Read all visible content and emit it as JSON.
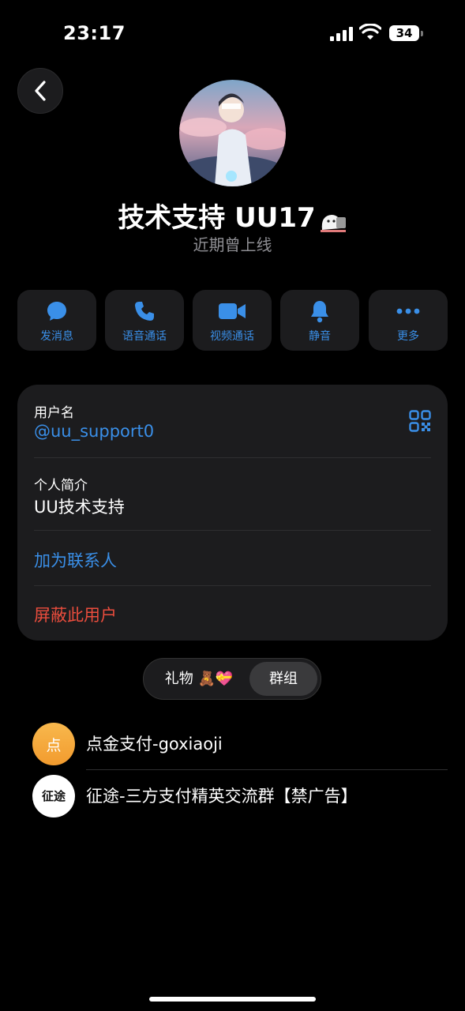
{
  "status_bar": {
    "time": "23:17",
    "battery": "34"
  },
  "profile": {
    "name": "技术支持 UU17",
    "last_seen": "近期曾上线"
  },
  "actions": [
    {
      "label": "发消息",
      "icon": "message-icon"
    },
    {
      "label": "语音通话",
      "icon": "phone-icon"
    },
    {
      "label": "视频通话",
      "icon": "video-icon"
    },
    {
      "label": "静音",
      "icon": "bell-icon"
    },
    {
      "label": "更多",
      "icon": "more-icon"
    }
  ],
  "info": {
    "username_label": "用户名",
    "username": "@uu_support0",
    "bio_label": "个人简介",
    "bio": "UU技术支持",
    "add_contact": "加为联系人",
    "block_user": "屏蔽此用户"
  },
  "tabs": {
    "gifts": "礼物",
    "gifts_emoji": "🧸💝",
    "groups": "群组"
  },
  "groups": [
    {
      "name": "点金支付-goxiaoji",
      "avatar_text": "点"
    },
    {
      "name": "征途-三方支付精英交流群【禁广告】",
      "avatar_text": "征途"
    }
  ],
  "colors": {
    "accent": "#3a8fe8",
    "danger": "#eb4d3d",
    "card": "#1c1c1e",
    "avatar_orange": "#f5a93b"
  }
}
